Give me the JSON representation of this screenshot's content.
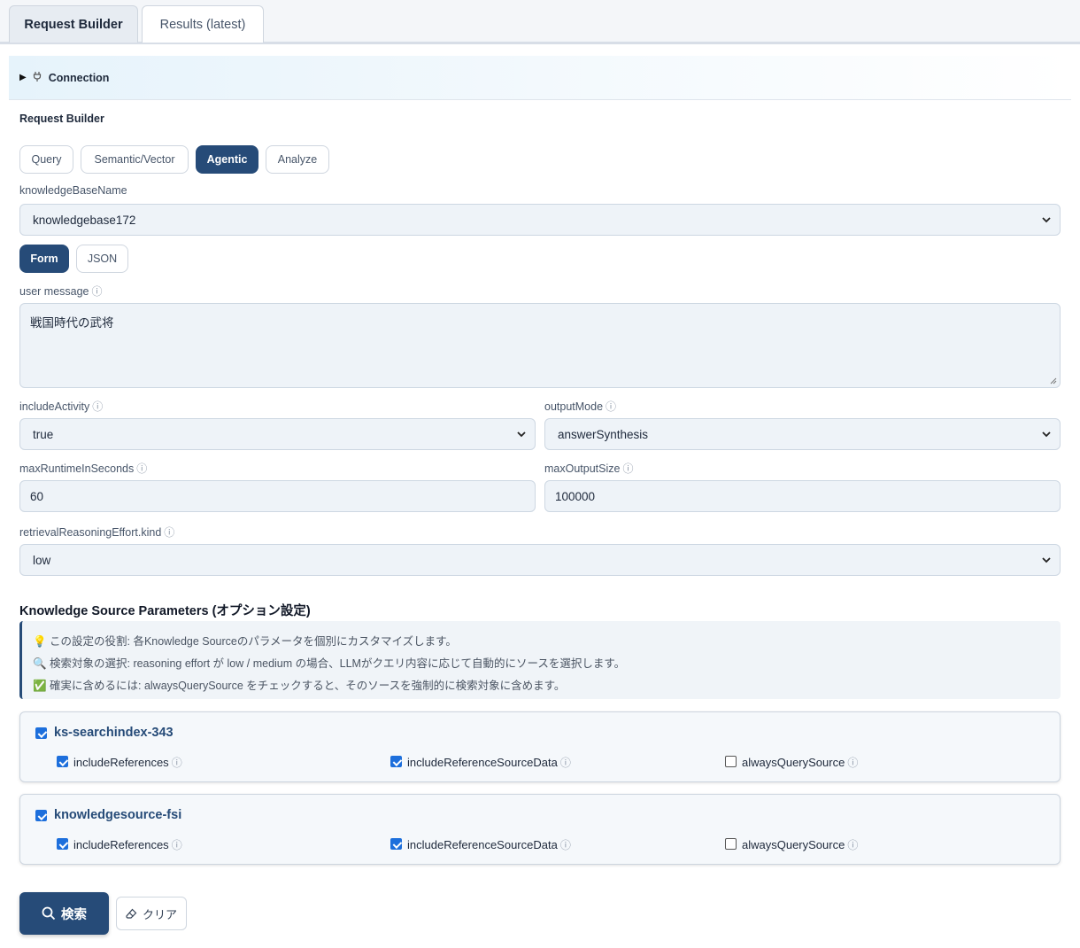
{
  "tabs": [
    {
      "label": "Request Builder",
      "active": true
    },
    {
      "label": "Results (latest)",
      "active": false
    }
  ],
  "connection": {
    "toggle": "▶",
    "icon": "plug-icon",
    "label": "Connection"
  },
  "section_title": "Request Builder",
  "mode_tabs": [
    {
      "label": "Query",
      "active": false
    },
    {
      "label": "Semantic/Vector",
      "active": false
    },
    {
      "label": "Agentic",
      "active": true
    },
    {
      "label": "Analyze",
      "active": false
    }
  ],
  "knowledge_base": {
    "label": "knowledgeBaseName",
    "value": "knowledgebase172"
  },
  "format_tabs": [
    {
      "label": "Form",
      "active": true
    },
    {
      "label": "JSON",
      "active": false
    }
  ],
  "info_glyph": "ⓘ",
  "fields": {
    "user_message": {
      "label": "user message",
      "value": "戦国時代の武将"
    },
    "include_activity": {
      "label": "includeActivity",
      "value": "true"
    },
    "output_mode": {
      "label": "outputMode",
      "value": "answerSynthesis"
    },
    "max_runtime": {
      "label": "maxRuntimeInSeconds",
      "value": "60"
    },
    "max_output_size": {
      "label": "maxOutputSize",
      "value": "100000"
    },
    "reasoning_effort": {
      "label": "retrievalReasoningEffort.kind",
      "value": "low"
    }
  },
  "ks_params": {
    "title": "Knowledge Source Parameters (オプション設定)",
    "notes": [
      {
        "icon": "💡",
        "text": "この設定の役割: 各Knowledge Sourceのパラメータを個別にカスタマイズします。"
      },
      {
        "icon": "🔍",
        "text": "検索対象の選択: reasoning effort が low / medium の場合、LLMがクエリ内容に応じて自動的にソースを選択します。"
      },
      {
        "icon": "✅",
        "text": "確実に含めるには: alwaysQuerySource をチェックすると、そのソースを強制的に検索対象に含めます。"
      }
    ],
    "sources": [
      {
        "name": "ks-searchindex-343",
        "checked": true,
        "options": [
          {
            "label": "includeReferences",
            "checked": true
          },
          {
            "label": "includeReferenceSourceData",
            "checked": true
          },
          {
            "label": "alwaysQuerySource",
            "checked": false
          }
        ]
      },
      {
        "name": "knowledgesource-fsi",
        "checked": true,
        "options": [
          {
            "label": "includeReferences",
            "checked": true
          },
          {
            "label": "includeReferenceSourceData",
            "checked": true
          },
          {
            "label": "alwaysQuerySource",
            "checked": false
          }
        ]
      }
    ]
  },
  "actions": {
    "search_label": "検索",
    "search_icon": "search-icon",
    "clear_label": "クリア",
    "clear_icon": "eraser-icon"
  },
  "colors": {
    "primary": "#264b78",
    "checkbox": "#1d6fdc",
    "field_bg": "#eef3f8"
  }
}
